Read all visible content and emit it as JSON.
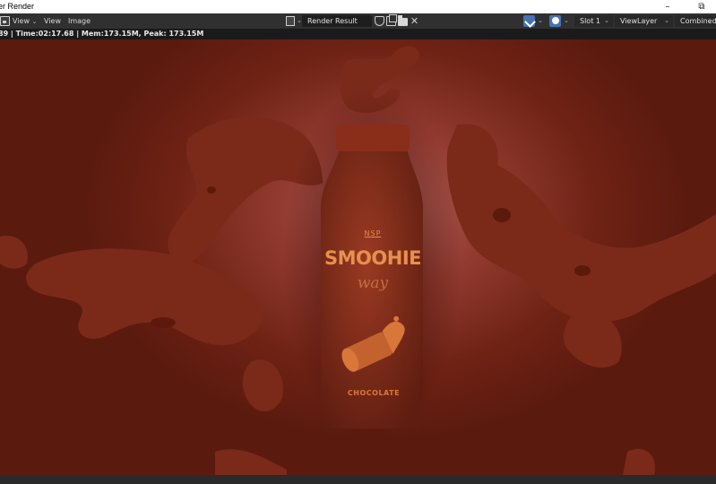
{
  "window": {
    "title": "ler Render",
    "minimize_label": "–",
    "restore_label": "⧉"
  },
  "header": {
    "editor_type_icon": "image-editor-icon",
    "menus": [
      {
        "label": "View",
        "has_dropdown": true
      },
      {
        "label": "View"
      },
      {
        "label": "Image"
      }
    ],
    "image_name": "Render Result",
    "icons": [
      "image-browse-icon",
      "fake-user-shield-icon",
      "new-image-icon",
      "open-image-folder-icon",
      "unlink-close-icon"
    ],
    "gizmo_icons": [
      "sample-tool-icon",
      "display-channels-icon"
    ],
    "slot": "Slot 1",
    "view_layer": "ViewLayer",
    "pass": "Combined",
    "accent_color": "#4772b3"
  },
  "meta": {
    "stats": "89 | Time:02:17.68 | Mem:173.15M, Peak: 173.15M"
  },
  "render": {
    "bottle_brand": "NSP",
    "bottle_product": "SMOOHIE",
    "bottle_tagline": "way",
    "bottle_flavor": "CHOCOLATE",
    "background_color": "#923a30",
    "liquid_color": "#7a2818"
  }
}
